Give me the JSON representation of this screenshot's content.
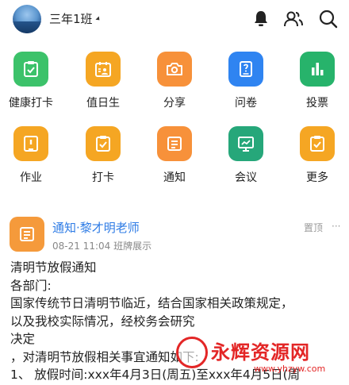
{
  "header": {
    "class_name": "三年1班",
    "icons": [
      "bell-icon",
      "contacts-icon",
      "search-icon"
    ]
  },
  "grid": [
    {
      "label": "健康打卡",
      "color": "#3cc26a",
      "icon": "health-checkin-icon"
    },
    {
      "label": "值日生",
      "color": "#f5a623",
      "icon": "duty-student-icon"
    },
    {
      "label": "分享",
      "color": "#f7913a",
      "icon": "camera-icon"
    },
    {
      "label": "问卷",
      "color": "#2f84f1",
      "icon": "questionnaire-icon"
    },
    {
      "label": "投票",
      "color": "#27b36b",
      "icon": "bar-chart-icon"
    },
    {
      "label": "作业",
      "color": "#f5a623",
      "icon": "homework-icon"
    },
    {
      "label": "打卡",
      "color": "#f5a623",
      "icon": "checkin-icon"
    },
    {
      "label": "通知",
      "color": "#f7913a",
      "icon": "notice-icon"
    },
    {
      "label": "会议",
      "color": "#26a77a",
      "icon": "meeting-icon"
    },
    {
      "label": "更多",
      "color": "#f5a623",
      "icon": "more-icon"
    }
  ],
  "feed": {
    "title": "通知·黎才明老师",
    "meta": "08-21 11:04  班牌展示",
    "pin": "置顶",
    "more": "···",
    "icon_color": "#f59a3b",
    "body": [
      "清明节放假通知",
      "各部门:",
      "国家传统节日清明节临近，结合国家相关政策规定，",
      "以及我校实际情况，经校务会研究",
      "决定",
      "，对清明节放假相关事宜通知如下:",
      "1、 放假时间:xxx年4月3日(周五)至xxx年4月5日(周"
    ]
  },
  "watermark": {
    "text": "永辉资源网",
    "url": "www.yhzyw.com"
  }
}
